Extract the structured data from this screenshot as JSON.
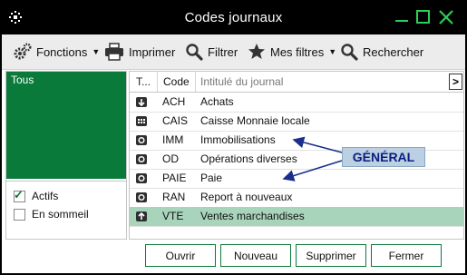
{
  "window": {
    "title": "Codes journaux"
  },
  "toolbar": {
    "fonctions": "Fonctions",
    "imprimer": "Imprimer",
    "filtrer": "Filtrer",
    "mes_filtres": "Mes filtres",
    "rechercher": "Rechercher"
  },
  "left_panel": {
    "tous": "Tous",
    "actifs": "Actifs",
    "actifs_checked": true,
    "en_sommeil": "En sommeil",
    "en_sommeil_checked": false
  },
  "grid": {
    "col_type": "T...",
    "col_code": "Code",
    "col_label_placeholder": "Intitulé du journal",
    "rows": [
      {
        "icon": "down-arrow-icon",
        "code": "ACH",
        "label": "Achats"
      },
      {
        "icon": "cash-register-icon",
        "code": "CAIS",
        "label": "Caisse Monnaie locale"
      },
      {
        "icon": "circle-icon",
        "code": "IMM",
        "label": "Immobilisations"
      },
      {
        "icon": "circle-icon",
        "code": "OD",
        "label": "Opérations diverses"
      },
      {
        "icon": "circle-icon",
        "code": "PAIE",
        "label": "Paie"
      },
      {
        "icon": "circle-icon",
        "code": "RAN",
        "label": "Report à nouveaux"
      },
      {
        "icon": "up-arrow-icon",
        "code": "VTE",
        "label": "Ventes marchandises"
      }
    ]
  },
  "buttons": {
    "ouvrir": "Ouvrir",
    "nouveau": "Nouveau",
    "supprimer": "Supprimer",
    "fermer": "Fermer"
  },
  "annotation": {
    "label": "GÉNÉRAL"
  },
  "colors": {
    "accent": "#0a7a3b",
    "selected_row": "#a9d4bc",
    "annotation_text": "#0b1e80"
  }
}
